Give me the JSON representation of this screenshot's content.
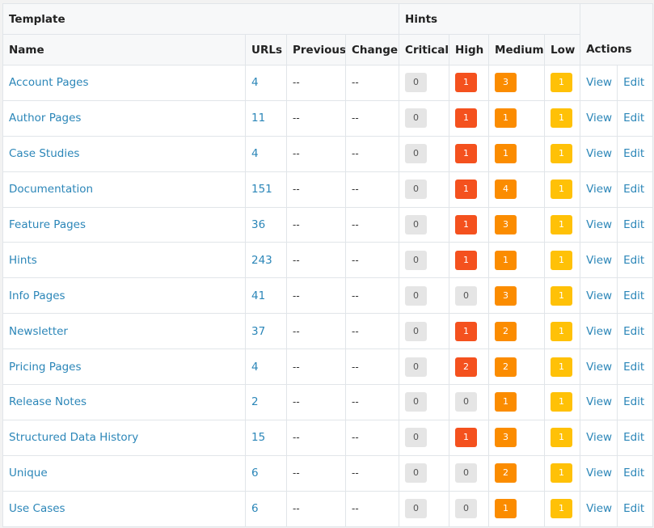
{
  "header": {
    "group_template": "Template",
    "group_hints": "Hints",
    "actions": "Actions",
    "columns": [
      "Name",
      "URLs",
      "Previous",
      "Change",
      "Critical",
      "High",
      "Medium",
      "Low"
    ]
  },
  "actions": {
    "view": "View",
    "edit": "Edit"
  },
  "colors": {
    "zero": "#e5e5e5",
    "high": "#f4511e",
    "medium": "#fb8c00",
    "low": "#ffc107",
    "link": "#2b86b8"
  },
  "rows": [
    {
      "name": "Account Pages",
      "urls": "4",
      "previous": "--",
      "change": "--",
      "critical": "0",
      "high": "1",
      "medium": "3",
      "low": "1"
    },
    {
      "name": "Author Pages",
      "urls": "11",
      "previous": "--",
      "change": "--",
      "critical": "0",
      "high": "1",
      "medium": "1",
      "low": "1"
    },
    {
      "name": "Case Studies",
      "urls": "4",
      "previous": "--",
      "change": "--",
      "critical": "0",
      "high": "1",
      "medium": "1",
      "low": "1"
    },
    {
      "name": "Documentation",
      "urls": "151",
      "previous": "--",
      "change": "--",
      "critical": "0",
      "high": "1",
      "medium": "4",
      "low": "1"
    },
    {
      "name": "Feature Pages",
      "urls": "36",
      "previous": "--",
      "change": "--",
      "critical": "0",
      "high": "1",
      "medium": "3",
      "low": "1"
    },
    {
      "name": "Hints",
      "urls": "243",
      "previous": "--",
      "change": "--",
      "critical": "0",
      "high": "1",
      "medium": "1",
      "low": "1"
    },
    {
      "name": "Info Pages",
      "urls": "41",
      "previous": "--",
      "change": "--",
      "critical": "0",
      "high": "0",
      "medium": "3",
      "low": "1"
    },
    {
      "name": "Newsletter",
      "urls": "37",
      "previous": "--",
      "change": "--",
      "critical": "0",
      "high": "1",
      "medium": "2",
      "low": "1"
    },
    {
      "name": "Pricing Pages",
      "urls": "4",
      "previous": "--",
      "change": "--",
      "critical": "0",
      "high": "2",
      "medium": "2",
      "low": "1"
    },
    {
      "name": "Release Notes",
      "urls": "2",
      "previous": "--",
      "change": "--",
      "critical": "0",
      "high": "0",
      "medium": "1",
      "low": "1"
    },
    {
      "name": "Structured Data History",
      "urls": "15",
      "previous": "--",
      "change": "--",
      "critical": "0",
      "high": "1",
      "medium": "3",
      "low": "1"
    },
    {
      "name": "Unique",
      "urls": "6",
      "previous": "--",
      "change": "--",
      "critical": "0",
      "high": "0",
      "medium": "2",
      "low": "1"
    },
    {
      "name": "Use Cases",
      "urls": "6",
      "previous": "--",
      "change": "--",
      "critical": "0",
      "high": "0",
      "medium": "1",
      "low": "1"
    }
  ]
}
